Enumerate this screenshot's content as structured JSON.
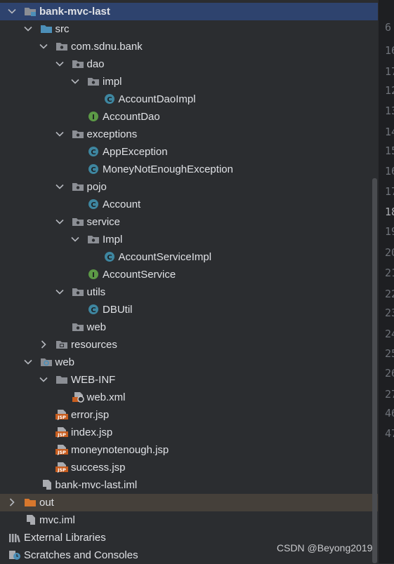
{
  "project_tree": {
    "items": [
      {
        "label": "bank-mvc-last",
        "icon": "module-folder-icon",
        "expanded": true,
        "bold": true,
        "selected": true
      },
      {
        "label": "src",
        "icon": "source-folder-icon",
        "expanded": true
      },
      {
        "label": "com.sdnu.bank",
        "icon": "package-icon",
        "expanded": true
      },
      {
        "label": "dao",
        "icon": "package-icon",
        "expanded": true
      },
      {
        "label": "impl",
        "icon": "package-icon",
        "expanded": true
      },
      {
        "label": "AccountDaoImpl",
        "icon": "java-class-icon"
      },
      {
        "label": "AccountDao",
        "icon": "java-interface-icon"
      },
      {
        "label": "exceptions",
        "icon": "package-icon",
        "expanded": true
      },
      {
        "label": "AppException",
        "icon": "java-class-icon"
      },
      {
        "label": "MoneyNotEnoughException",
        "icon": "java-class-icon"
      },
      {
        "label": "pojo",
        "icon": "package-icon",
        "expanded": true
      },
      {
        "label": "Account",
        "icon": "java-class-icon"
      },
      {
        "label": "service",
        "icon": "package-icon",
        "expanded": true
      },
      {
        "label": "Impl",
        "icon": "package-icon",
        "expanded": true
      },
      {
        "label": "AccountServiceImpl",
        "icon": "java-class-icon"
      },
      {
        "label": "AccountService",
        "icon": "java-interface-icon"
      },
      {
        "label": "utils",
        "icon": "package-icon",
        "expanded": true
      },
      {
        "label": "DBUtil",
        "icon": "java-class-icon"
      },
      {
        "label": "web",
        "icon": "package-icon"
      },
      {
        "label": "resources",
        "icon": "resources-folder-icon",
        "expanded": false
      },
      {
        "label": "web",
        "icon": "web-folder-icon",
        "expanded": true
      },
      {
        "label": "WEB-INF",
        "icon": "folder-icon",
        "expanded": true
      },
      {
        "label": "web.xml",
        "icon": "xml-file-icon"
      },
      {
        "label": "error.jsp",
        "icon": "jsp-file-icon"
      },
      {
        "label": "index.jsp",
        "icon": "jsp-file-icon"
      },
      {
        "label": "moneynotenough.jsp",
        "icon": "jsp-file-icon"
      },
      {
        "label": "success.jsp",
        "icon": "jsp-file-icon"
      },
      {
        "label": "bank-mvc-last.iml",
        "icon": "iml-file-icon"
      },
      {
        "label": "out",
        "icon": "excluded-folder-icon",
        "expanded": false,
        "highlighted": true
      },
      {
        "label": "mvc.iml",
        "icon": "iml-file-icon"
      },
      {
        "label": "External Libraries",
        "icon": "libraries-icon"
      },
      {
        "label": "Scratches and Consoles",
        "icon": "scratches-icon"
      }
    ],
    "jsp_badge": "JSP"
  },
  "editor_gutter": {
    "line_numbers": [
      "6",
      "16",
      "17",
      "12",
      "13",
      "14",
      "15",
      "16",
      "17",
      "18",
      "19",
      "20",
      "21",
      "22",
      "23",
      "24",
      "25",
      "26",
      "27",
      "46",
      "47"
    ],
    "current_line": "18"
  },
  "watermark": "CSDN @Beyong2019",
  "colors": {
    "background": "#2b2d30",
    "selection": "#2e436e",
    "highlight": "#45403a",
    "class_icon": "#3e86a0",
    "interface_icon": "#5c9a46",
    "jsp_icon": "#c75d1f",
    "folder_blue": "#4c8fb8",
    "folder_gray": "#8b8e94",
    "excluded_folder": "#d7772d"
  }
}
